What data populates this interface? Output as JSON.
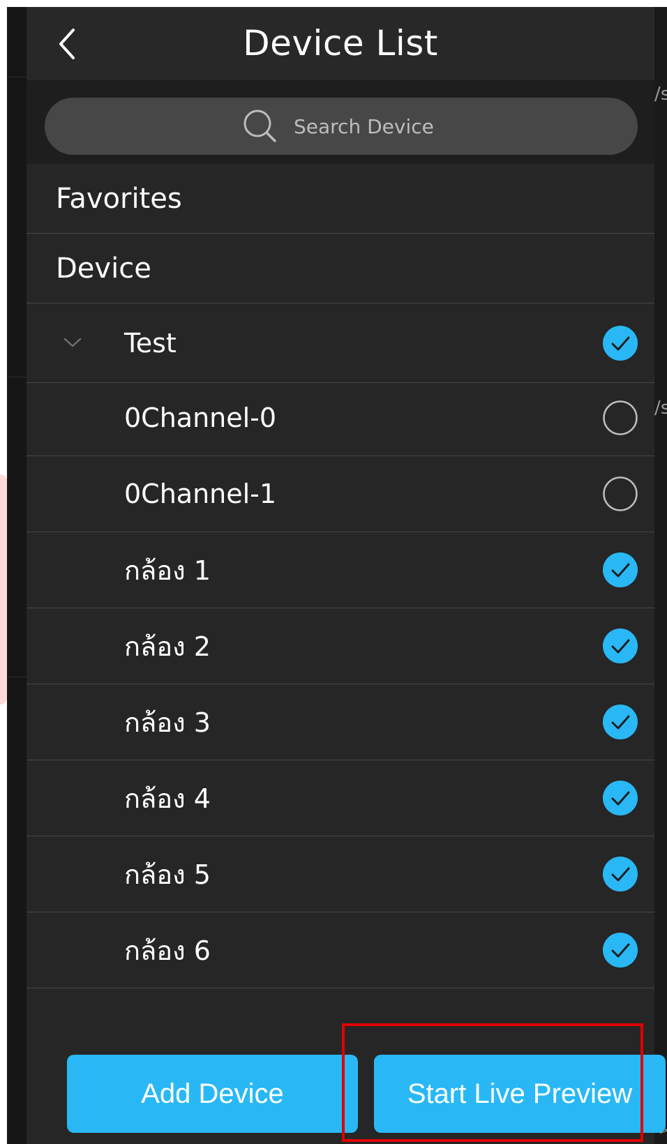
{
  "header": {
    "title": "Device List",
    "back_icon": "chevron-left-icon"
  },
  "search": {
    "placeholder": "Search Device",
    "icon": "search-icon"
  },
  "sections": {
    "favorites_label": "Favorites",
    "device_label": "Device"
  },
  "device_group": {
    "name": "Test",
    "expanded": true,
    "checked": true
  },
  "channels": [
    {
      "label": "0Channel-0",
      "checked": false
    },
    {
      "label": "0Channel-1",
      "checked": false
    },
    {
      "label": "กล้อง 1",
      "checked": true
    },
    {
      "label": "กล้อง 2",
      "checked": true
    },
    {
      "label": "กล้อง 3",
      "checked": true
    },
    {
      "label": "กล้อง 4",
      "checked": true
    },
    {
      "label": "กล้อง 5",
      "checked": true
    },
    {
      "label": "กล้อง 6",
      "checked": true
    }
  ],
  "buttons": {
    "add_device": "Add Device",
    "start_live_preview": "Start Live Preview"
  },
  "background_peek": {
    "text_1": "/s",
    "text_2": "/s",
    "text_3": ">"
  },
  "colors": {
    "accent": "#29b8f5",
    "panel_bg": "#262626",
    "highlight": "#e00000"
  }
}
